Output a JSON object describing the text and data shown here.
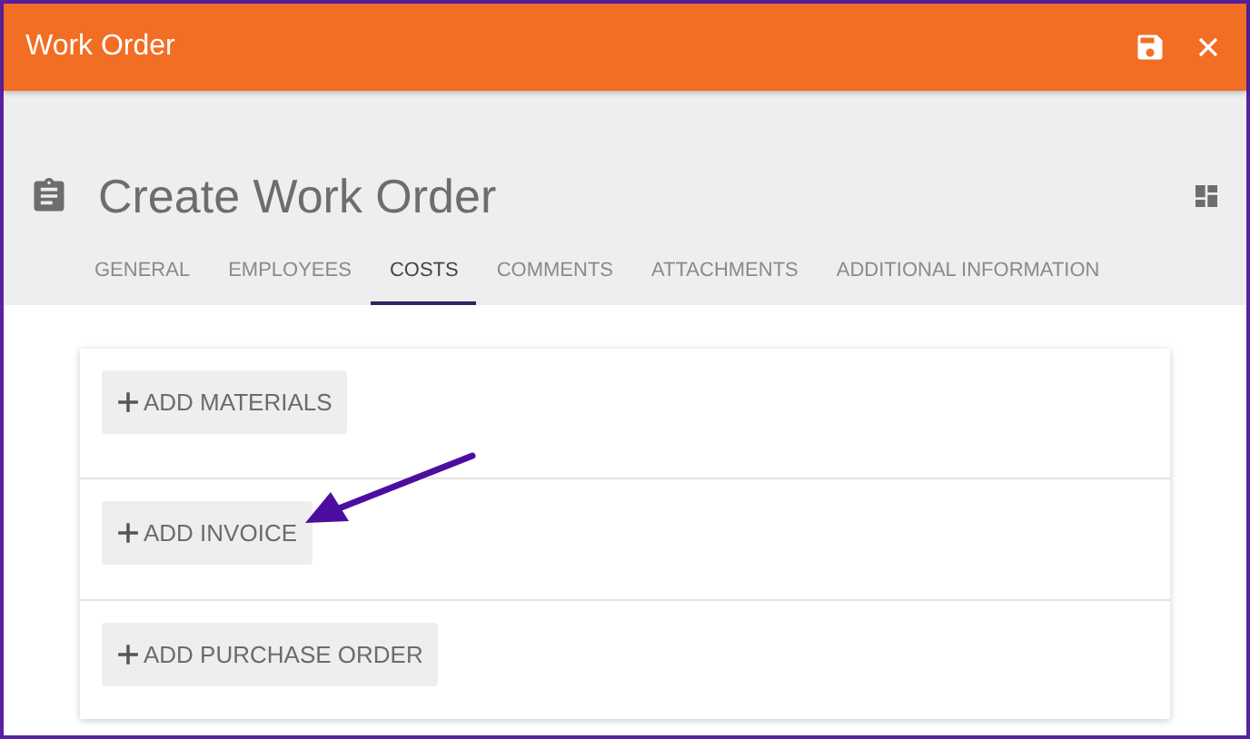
{
  "window": {
    "title": "Work Order"
  },
  "header": {
    "title": "Create Work Order"
  },
  "tabs": [
    {
      "label": "GENERAL",
      "selected": false
    },
    {
      "label": "EMPLOYEES",
      "selected": false
    },
    {
      "label": "COSTS",
      "selected": true
    },
    {
      "label": "COMMENTS",
      "selected": false
    },
    {
      "label": "ATTACHMENTS",
      "selected": false
    },
    {
      "label": "ADDITIONAL INFORMATION",
      "selected": false
    }
  ],
  "cost_actions": [
    {
      "label": "ADD MATERIALS"
    },
    {
      "label": "ADD INVOICE"
    },
    {
      "label": "ADD PURCHASE ORDER"
    }
  ]
}
